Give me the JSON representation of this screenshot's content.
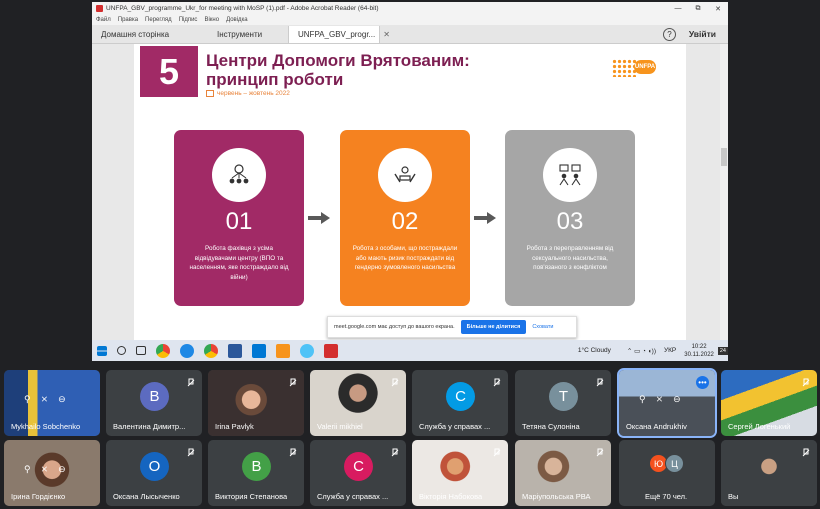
{
  "window": {
    "title": "UNFPA_GBV_programme_Ukr_for meeting with MoSP (1).pdf - Adobe Acrobat Reader (64-bit)",
    "controls": [
      "—",
      "⧉",
      "✕"
    ]
  },
  "menu": [
    "Файл",
    "Правка",
    "Перегляд",
    "Підпис",
    "Вікно",
    "Довідка"
  ],
  "tabs": {
    "home": "Домашня сторінка",
    "tools": "Інструменти",
    "doc": "UNFPA_GBV_progr...",
    "help": "?",
    "signin": "Увійти"
  },
  "slide": {
    "number": "5",
    "title": "Центри Допомоги Врятованим: принцип роботи",
    "date": "червень – жовтень 2022",
    "logo": "UNFPA",
    "cards": [
      {
        "num": "01",
        "desc": "Робота фахівця з усіма відвідувачами центру (ВПО та населенням, яке постраждало від війни)",
        "color": "#a12a66"
      },
      {
        "num": "02",
        "desc": "Робота з особами, що постраждали або мають ризик постраждати від гендерно зумовленого насильства",
        "color": "#f58220"
      },
      {
        "num": "03",
        "desc": "Робота з переправленням від сексуального насильства, пов'язаного з конфліктом",
        "color": "#a6a6a6"
      }
    ]
  },
  "sharing_notice": {
    "text": "meet.google.com має доступ до вашого екрана.",
    "stop": "Більше не ділитися",
    "hide": "Сховати"
  },
  "taskbar": {
    "weather": "1°C  Cloudy",
    "lang": "УКР",
    "time": "10:22",
    "date": "30.11.2022",
    "notifications": "24"
  },
  "participants": [
    {
      "name": "Mykhailo Sobchenko",
      "type": "video",
      "pin": true
    },
    {
      "name": "Валентина Димитр...",
      "type": "avatar",
      "letter": "В",
      "color": "#5c6bc0"
    },
    {
      "name": "Irina Pavlyk",
      "type": "video"
    },
    {
      "name": "Valerii mikhiel",
      "type": "video"
    },
    {
      "name": "Служба у справах ...",
      "type": "avatar",
      "letter": "С",
      "color": "#039be5"
    },
    {
      "name": "Тетяна Сулоніна",
      "type": "avatar",
      "letter": "Т",
      "color": "#78909c"
    },
    {
      "name": "Оксана Andrukhiv",
      "type": "video",
      "active": true
    },
    {
      "name": "Сергей Логенький",
      "type": "video"
    },
    {
      "name": "Ірина Гордієнко",
      "type": "video",
      "pin": true
    },
    {
      "name": "Оксана Лысыченко",
      "type": "avatar",
      "letter": "О",
      "color": "#1565c0"
    },
    {
      "name": "Виктория Степанова",
      "type": "avatar",
      "letter": "В",
      "color": "#43a047"
    },
    {
      "name": "Служба у справах ...",
      "type": "avatar",
      "letter": "С",
      "color": "#d81b60"
    },
    {
      "name": "Вікторія Набокова",
      "type": "video"
    },
    {
      "name": "Маріупольська РВА",
      "type": "video"
    },
    {
      "name": "Ещё 70 чел.",
      "type": "others",
      "letters": [
        "Ю",
        "Ц"
      ]
    },
    {
      "name": "Вы",
      "type": "video"
    }
  ]
}
